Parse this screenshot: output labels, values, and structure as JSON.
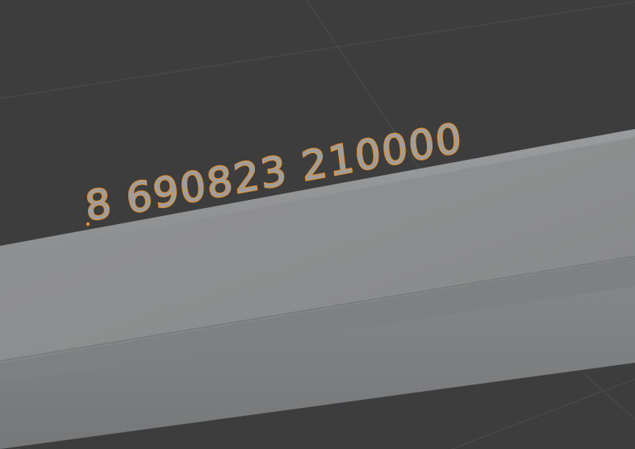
{
  "viewport": {
    "background_color": "#3d3d3d",
    "grid_color": "#4a4a4a"
  },
  "selected_object": {
    "text": "8 690823 210000",
    "fill_color": "#9e9e9e",
    "outline_color": "#e6902e",
    "selected": true
  },
  "mesh": {
    "top_face_color": "#8e8f90",
    "front_face_color": "#7c7d7e"
  }
}
